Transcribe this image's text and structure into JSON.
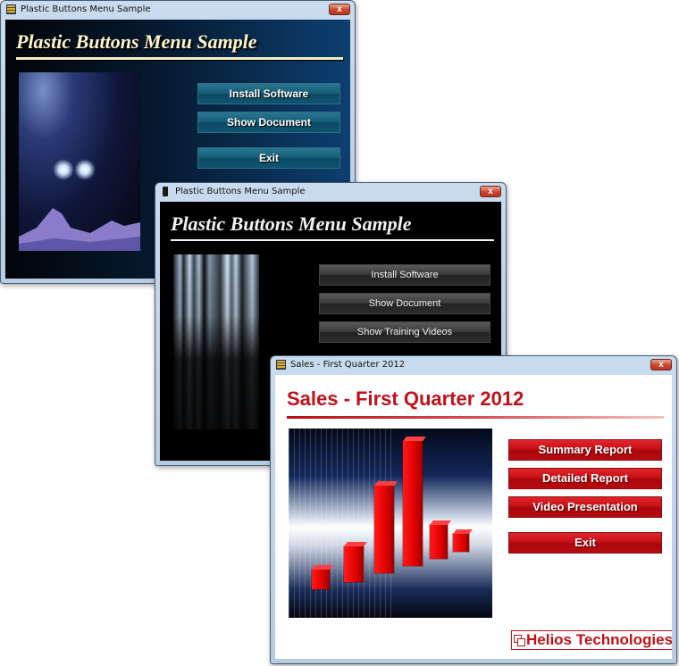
{
  "windows": [
    {
      "title": "Plastic Buttons Menu Sample",
      "heading": "Plastic Buttons Menu Sample",
      "close_label": "x",
      "buttons": [
        "Install Software",
        "Show Document",
        "Exit"
      ]
    },
    {
      "title": "Plastic Buttons Menu Sample",
      "heading": "Plastic Buttons Menu Sample",
      "close_label": "x",
      "buttons": [
        "Install Software",
        "Show Document",
        "Show Training Videos"
      ]
    },
    {
      "title": "Sales - First Quarter 2012",
      "heading": "Sales - First Quarter 2012",
      "close_label": "x",
      "buttons": [
        "Summary Report",
        "Detailed Report",
        "Video Presentation",
        "Exit"
      ],
      "logo_text": "Helios Technologies",
      "accent_color": "#c0111a"
    }
  ]
}
